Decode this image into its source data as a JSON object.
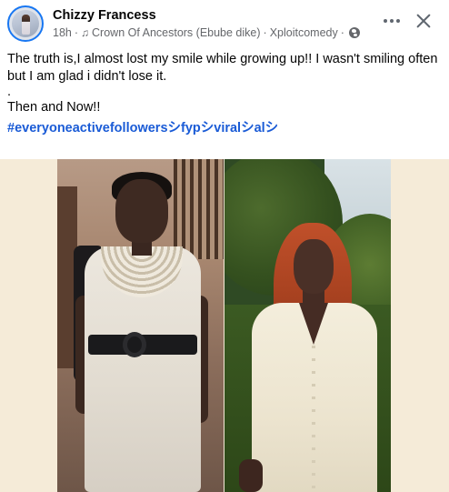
{
  "post": {
    "author": "Chizzy Francess",
    "time": "18h",
    "separator": "·",
    "song": "Crown Of Ancestors (Ebube dike)",
    "separator2": "·",
    "page": "Xploitcomedy",
    "separator3": "·",
    "body_line1": "The truth is,I almost lost my smile while growing up!! I wasn't smiling often but I am glad i didn't lose it.",
    "body_line2": ".",
    "body_line3": "Then and Now!!",
    "hashtags": "#everyoneactivefollowersシfypシviralシalシ"
  },
  "icons": {
    "more": "more-horizontal-icon",
    "close": "close-icon",
    "music": "music-note-icon",
    "privacy": "globe-icon"
  },
  "colors": {
    "link": "#1a5bd6",
    "meta": "#65676b",
    "media_bg": "#f5ebd8"
  }
}
